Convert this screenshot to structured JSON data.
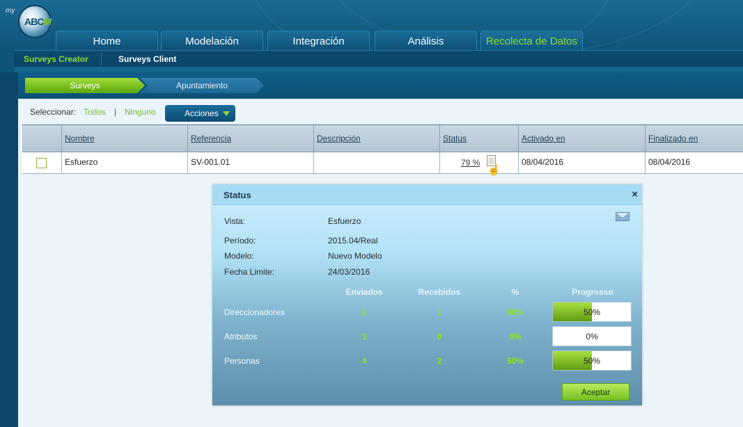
{
  "app": {
    "logo_prefix": "my",
    "logo_text": "ABC",
    "logo_text_accent": "M"
  },
  "main_tabs": [
    {
      "label": "Home",
      "active": false
    },
    {
      "label": "Modelación",
      "active": false
    },
    {
      "label": "Integración",
      "active": false
    },
    {
      "label": "Análisis",
      "active": false
    },
    {
      "label": "Recolecta de Datos",
      "active": true
    }
  ],
  "subnav": [
    {
      "label": "Surveys Creator",
      "active": true
    },
    {
      "label": "Surveys Client",
      "active": false
    }
  ],
  "steps": [
    {
      "label": "Surveys",
      "active": true
    },
    {
      "label": "Apuntamiento",
      "active": false
    }
  ],
  "toolbar": {
    "select_label": "Seleccionar:",
    "select_all": "Todos",
    "separator": "|",
    "select_none": "Ninguno",
    "actions_label": "Acciones"
  },
  "table": {
    "columns": [
      "Nombre",
      "Referencia",
      "Descripción",
      "Status",
      "Activado en",
      "Finalizado en"
    ],
    "rows": [
      {
        "checked": false,
        "nombre": "Esfuerzo",
        "referencia": "SV-001.01",
        "descripcion": "",
        "status": "79 %",
        "activado_en": "08/04/2016",
        "finalizado_en": "08/04/2016"
      }
    ]
  },
  "modal": {
    "title": "Status",
    "close": "×",
    "fields": [
      {
        "label": "Vista:",
        "value": "Esfuerzo"
      },
      {
        "label": "Período:",
        "value": "2015.04/Real"
      },
      {
        "label": "Modelo:",
        "value": "Nuevo Modelo"
      },
      {
        "label": "Fecha Limite:",
        "value": "24/03/2016"
      }
    ],
    "columns": [
      "Enviados",
      "Recebidos",
      "%",
      "Progresso"
    ],
    "rows": [
      {
        "label": "Direccionadores",
        "enviados": "2",
        "recebidos": "1",
        "pct": "50%",
        "progress": 0.5,
        "progress_text": "50%"
      },
      {
        "label": "Atributos",
        "enviados": "1",
        "recebidos": "0",
        "pct": "0%",
        "progress": 0.0,
        "progress_text": "0%"
      },
      {
        "label": "Personas",
        "enviados": "4",
        "recebidos": "2",
        "pct": "50%",
        "progress": 0.5,
        "progress_text": "50%"
      }
    ],
    "accept_label": "Aceptar"
  },
  "colors": {
    "accent_green": "#8fdc34",
    "nav_blue": "#0e5479",
    "progress_fill": "#76bf22"
  }
}
